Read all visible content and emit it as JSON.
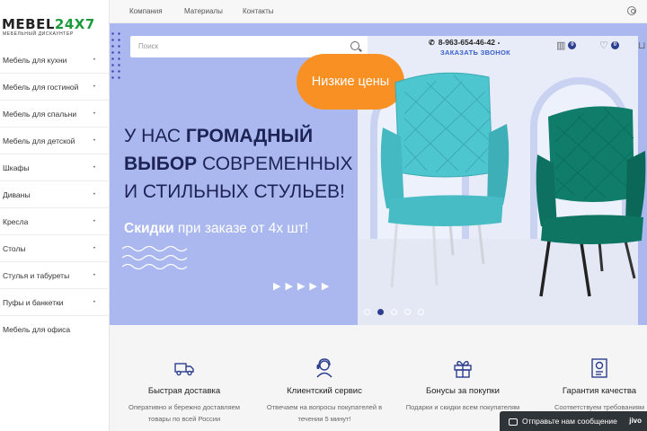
{
  "logo": {
    "text_main": "MEBEL",
    "text_accent": "24X7",
    "tagline": "МЕБЕЛЬНЫЙ ДИСКАУНТЕР"
  },
  "sidebar": {
    "items": [
      {
        "label": "Мебель для кухни"
      },
      {
        "label": "Мебель для гостиной"
      },
      {
        "label": "Мебель для спальни"
      },
      {
        "label": "Мебель для детской"
      },
      {
        "label": "Шкафы"
      },
      {
        "label": "Диваны"
      },
      {
        "label": "Кресла"
      },
      {
        "label": "Столы"
      },
      {
        "label": "Стулья и табуреты"
      },
      {
        "label": "Пуфы и банкетки"
      },
      {
        "label": "Мебель для офиса"
      }
    ]
  },
  "topnav": {
    "links": [
      "Компания",
      "Материалы",
      "Контакты"
    ]
  },
  "header": {
    "search_placeholder": "Поиск",
    "phone": "8-963-654-46-42",
    "callback": "ЗАКАЗАТЬ ЗВОНОК",
    "compare_count": "0",
    "favorites_count": "0",
    "cart_count": "0"
  },
  "hero": {
    "promo_badge": "Низкие цены",
    "headline_l1_normal": "У НАС ",
    "headline_l1_bold": "ГРОМАДНЫЙ",
    "headline_l2_bold": "ВЫБОР",
    "headline_l2_normal": " СОВРЕМЕННЫХ",
    "headline_l3": "И СТИЛЬНЫХ СТУЛЬЕВ!",
    "discount_bold": "Скидки",
    "discount_normal": " при заказе от 4х шт!",
    "chevrons": "▶▶▶▶▶",
    "slides_total": 5,
    "active_slide": 2
  },
  "features": [
    {
      "icon": "delivery-truck-icon",
      "title": "Быстрая доставка",
      "desc": "Оперативно и бережно доставляем товары по всей России"
    },
    {
      "icon": "support-agent-icon",
      "title": "Клиентский сервис",
      "desc": "Отвечаем на вопросы покупателей в течении 5 минут!"
    },
    {
      "icon": "gift-icon",
      "title": "Бонусы за покупки",
      "desc": "Подарки и скидки всем покупателям"
    },
    {
      "icon": "certificate-icon",
      "title": "Гарантия качества",
      "desc": "Соответствуем требованиям"
    }
  ],
  "chat": {
    "label": "Отправьте нам сообщение",
    "brand": "jivo"
  },
  "colors": {
    "hero_bg": "#aab8ef",
    "promo": "#f99024",
    "badge": "#2c3e8f",
    "accent_green": "#1a9a3a",
    "chair_left": "#4ec6cf",
    "chair_right": "#0f7d6a"
  }
}
